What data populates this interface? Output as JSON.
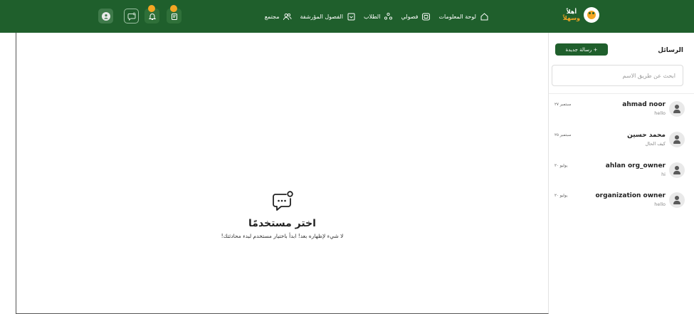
{
  "header": {
    "logo_line1": "أهلاً",
    "logo_line2": "وسهلاً",
    "nav": [
      {
        "label": "لوحة المعلومات",
        "icon": "home-icon"
      },
      {
        "label": "فصولي",
        "icon": "classes-icon"
      },
      {
        "label": "الطلاب",
        "icon": "students-icon"
      },
      {
        "label": "الفصول المؤرشفة",
        "icon": "archive-icon"
      },
      {
        "label": "مجتمع",
        "icon": "community-icon"
      }
    ],
    "actions": [
      "clipboard-icon",
      "bell-icon",
      "chat-icon",
      "avatar-icon"
    ],
    "colors": {
      "primary": "#1f5f2c",
      "accent": "#f4a623"
    }
  },
  "sidebar": {
    "title": "الرسائل",
    "new_message_label": "+ رسالة جديدة",
    "search_placeholder": "ابحث عن طريق الاسم",
    "conversations": [
      {
        "name": "ahmad noor",
        "preview": "hello",
        "time": "سبتمبر ٢٧"
      },
      {
        "name": "محمد حسين",
        "preview": "كيف الحال",
        "time": "سبتمبر ٢٥"
      },
      {
        "name": "ahlan org_owner",
        "preview": "hi",
        "time": "يوليو ٢٠"
      },
      {
        "name": "organization owner",
        "preview": "hello",
        "time": "يوليو ٢٠"
      }
    ]
  },
  "main": {
    "empty_title": "اختر مستخدمًا",
    "empty_description": "لا شيء لإظهاره بعد! ابدأ باختيار مستخدم لبدء محادثتك!"
  }
}
